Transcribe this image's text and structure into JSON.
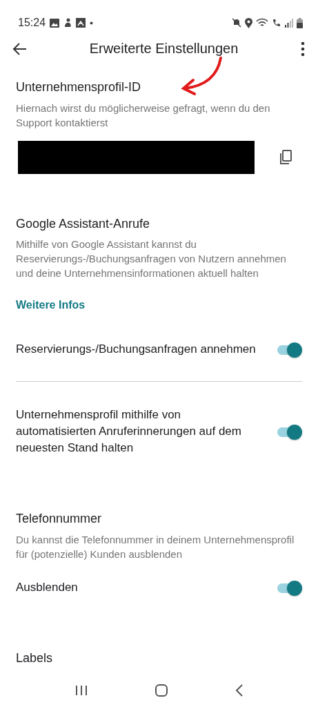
{
  "status_bar": {
    "time": "15:24"
  },
  "toolbar": {
    "title": "Erweiterte Einstellungen"
  },
  "profile_id": {
    "heading": "Unternehmensprofil-ID",
    "description": "Hiernach wirst du möglicherweise gefragt, wenn du den Support kontaktierst",
    "redacted": true
  },
  "assistant": {
    "heading": "Google Assistant-Anrufe",
    "description": "Mithilfe von Google Assistant kannst du Reservierungs-/Buchungsanfragen von Nutzern annehmen und deine Unternehmensinformationen aktuell halten",
    "link": "Weitere Infos",
    "toggles": [
      {
        "label": "Reservierungs-/Buchungsanfragen annehmen",
        "on": true
      },
      {
        "label": "Unternehmensprofil mithilfe von automatisierten Anruferinnerungen auf dem neuesten Stand halten",
        "on": true
      }
    ]
  },
  "phone": {
    "heading": "Telefonnummer",
    "description": "Du kannst die Telefonnummer in deinem Unternehmensprofil für (potenzielle) Kunden ausblenden",
    "toggles": [
      {
        "label": "Ausblenden",
        "on": true
      }
    ]
  },
  "labels": {
    "heading": "Labels"
  }
}
